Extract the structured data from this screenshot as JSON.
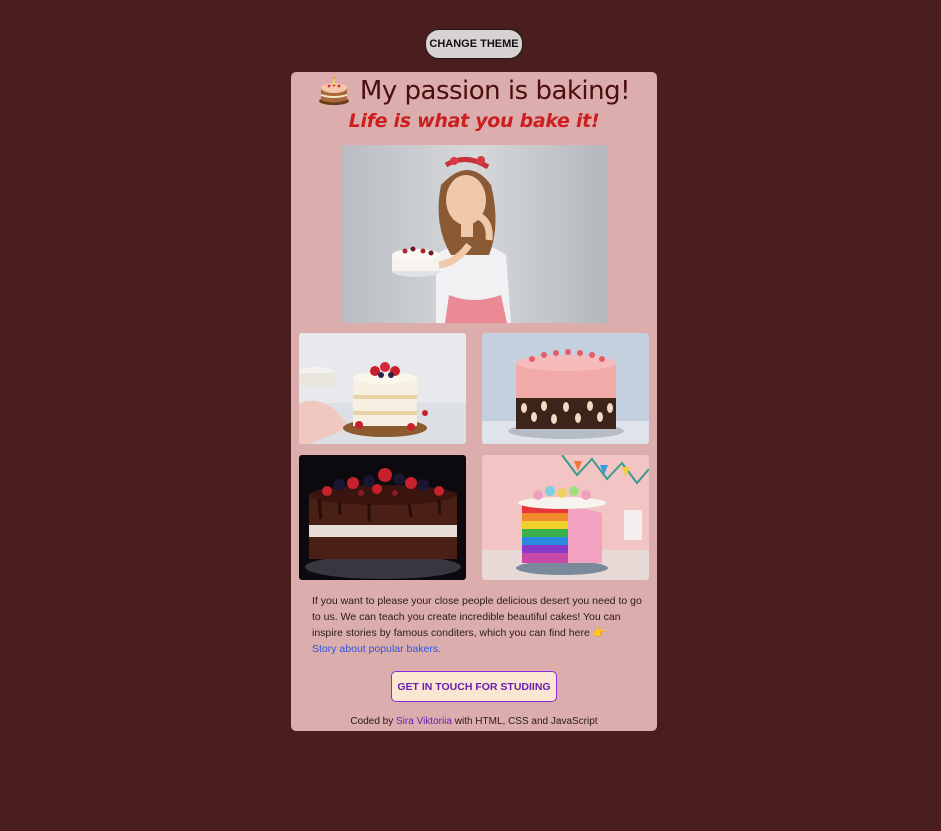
{
  "toolbar": {
    "theme_button": "CHANGE THEME"
  },
  "header": {
    "icon": "cake-icon",
    "title": "My passion is baking!",
    "subtitle": "Life is what you bake it!"
  },
  "images": {
    "hero": "woman holding a cake",
    "gallery": [
      "naked cake with berries",
      "pink cake with marshmallows",
      "chocolate cake with berries",
      "rainbow layer cake"
    ]
  },
  "description": {
    "text": "If you want to please your close people delicious desert you need to go to us. We can teach you create incredible beautiful cakes! You can inspire stories by famous conditers, which you can find here",
    "pointer_icon": "pointing-hand-icon",
    "link": "Story about popular bakers."
  },
  "cta": {
    "label": "GET IN TOUCH FOR STUDIING"
  },
  "footer": {
    "prefix": "Coded by",
    "author": "Sira Viktoriia",
    "suffix": "with HTML, CSS and JavaScript"
  },
  "colors": {
    "page_background": "#4b1e1e",
    "card_background": "#dbadad",
    "title": "#4b0d0d",
    "subtitle": "#cc1e1e",
    "link": "#2b55e6",
    "accent": "#8a2be2"
  }
}
